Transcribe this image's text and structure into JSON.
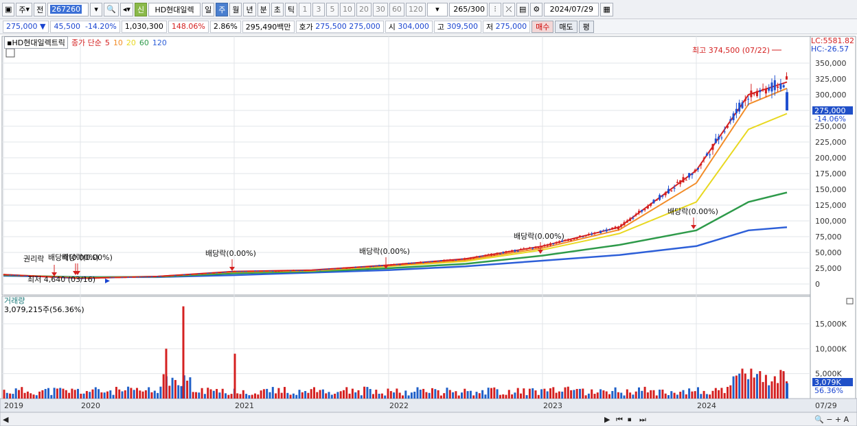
{
  "toolbar": {
    "type_label": "주",
    "jeon_label": "전",
    "stock_code": "267260",
    "shin_label": "신",
    "stock_name": "HD현대일렉",
    "period_tabs": [
      "일",
      "주",
      "월",
      "년",
      "분",
      "초",
      "틱"
    ],
    "active_period": "주",
    "intervals": [
      "1",
      "3",
      "5",
      "10",
      "20",
      "30",
      "60",
      "120"
    ],
    "count": "265",
    "count_total": "/300",
    "date": "2024/07/29"
  },
  "quote": {
    "price": "275,000",
    "change": "45,500",
    "change_pct": "-14.20%",
    "volume": "1,030,300",
    "volume_pct": "148.06%",
    "turnover": "2.86%",
    "amount": "295,490백만",
    "hoga_label": "호가",
    "ask": "275,500",
    "bid": "275,000",
    "open_label": "시",
    "open": "304,000",
    "high_label": "고",
    "high": "309,500",
    "low_label": "저",
    "low": "275,000",
    "buy_label": "매수",
    "sell_label": "매도",
    "pyeong_label": "평"
  },
  "legend": {
    "stock_name": "HD현대일렉트릭",
    "close_label": "종가 단순",
    "ma": [
      "5",
      "10",
      "20",
      "60",
      "120"
    ],
    "ma_colors": [
      "#d42020",
      "#f28c28",
      "#e8d820",
      "#2e9a4a",
      "#2d5fd8"
    ]
  },
  "volume_legend": {
    "label": "거래량",
    "value": "3,079,215주(56.36%)"
  },
  "annotations": {
    "max": "최고 374,500 (07/22)",
    "min": "최저 4,640 (03/16)",
    "events": [
      "권리락",
      "배당락(0.00%)",
      "배당락(0.00%)",
      "배당락(0.00%)",
      "배당락(0.00%)",
      "배당락(0.00%)",
      "배당락(0.00%)"
    ]
  },
  "right_axis": {
    "lc": "LC:5581.82",
    "hc": "HC:-26.57",
    "price_tag": "275,000",
    "pct_tag": "-14.06%",
    "vol_tag": "3,079K",
    "vol_pct_tag": "56.36%",
    "last_date": "07/29"
  },
  "chart_data": [
    {
      "type": "line",
      "title": "HD현대일렉트릭 주봉",
      "x": [
        "2019",
        "2020",
        "2021",
        "2022",
        "2023",
        "2024"
      ],
      "ylim": [
        0,
        375000
      ],
      "y_ticks": [
        "0",
        "25,000",
        "50,000",
        "75,000",
        "100,000",
        "125,000",
        "150,000",
        "175,000",
        "200,000",
        "225,000",
        "250,000",
        "275,000",
        "300,000",
        "325,000",
        "350,000"
      ],
      "series": [
        {
          "name": "5",
          "values": [
            15000,
            9000,
            12000,
            20000,
            22000,
            30000,
            40000,
            60000,
            90000,
            180000,
            300000,
            320000
          ]
        },
        {
          "name": "10",
          "values": [
            15000,
            9000,
            12000,
            19500,
            21500,
            29000,
            38000,
            57000,
            86000,
            160000,
            285000,
            310000
          ]
        },
        {
          "name": "20",
          "values": [
            15000,
            9500,
            12000,
            19000,
            21000,
            28000,
            36000,
            54000,
            80000,
            130000,
            245000,
            270000
          ]
        },
        {
          "name": "60",
          "values": [
            14000,
            10500,
            11500,
            17000,
            20000,
            25000,
            32000,
            45000,
            62000,
            85000,
            130000,
            145000
          ]
        },
        {
          "name": "120",
          "values": [
            13000,
            11000,
            11000,
            14000,
            18000,
            22000,
            28000,
            37000,
            46000,
            60000,
            85000,
            90000
          ]
        }
      ],
      "max": {
        "value": 374500,
        "date": "07/22"
      },
      "min": {
        "value": 4640,
        "date": "03/16"
      },
      "last_close": 275000
    },
    {
      "type": "bar",
      "title": "거래량",
      "x": [
        "2019",
        "2020",
        "2021",
        "2022",
        "2023",
        "2024"
      ],
      "y_ticks": [
        "5,000K",
        "10,000K",
        "15,000K"
      ],
      "ylim": [
        0,
        18500
      ],
      "last_value": 3079
    }
  ]
}
